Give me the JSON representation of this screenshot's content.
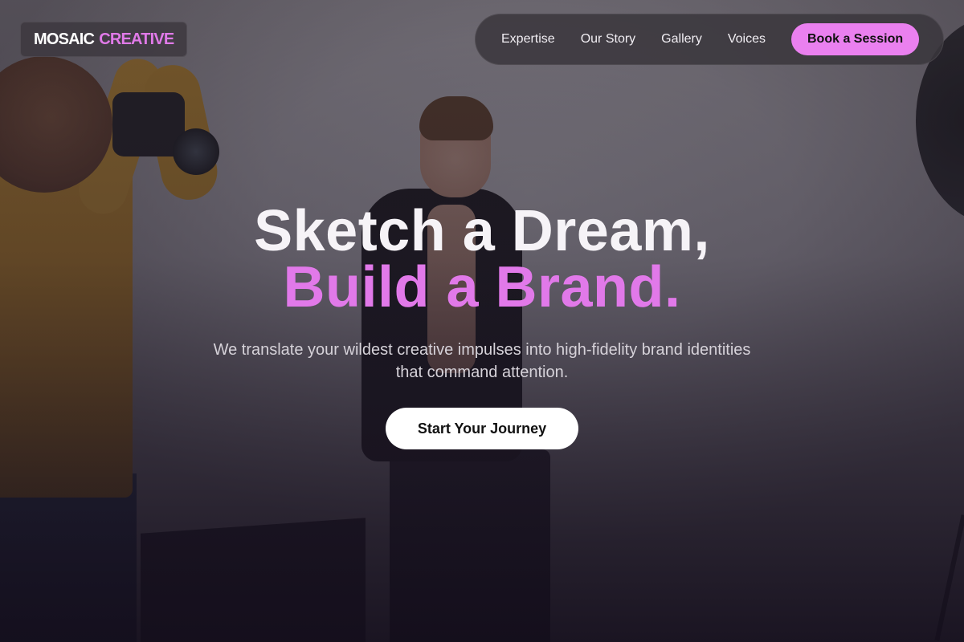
{
  "brand": {
    "name_part1": "MOSAIC",
    "name_part2": "CREATIVE",
    "accent_color": "#e07ae8"
  },
  "nav": {
    "items": [
      {
        "label": "Expertise"
      },
      {
        "label": "Our Story"
      },
      {
        "label": "Gallery"
      },
      {
        "label": "Voices"
      }
    ],
    "cta_label": "Book a Session"
  },
  "hero": {
    "headline_line1": "Sketch a Dream,",
    "headline_line2": "Build a Brand.",
    "subtitle": "We translate your wildest creative impulses into high-fidelity brand identities that command attention.",
    "button_label": "Start Your Journey"
  },
  "background": {
    "description_icon": "photo-shoot-background"
  }
}
